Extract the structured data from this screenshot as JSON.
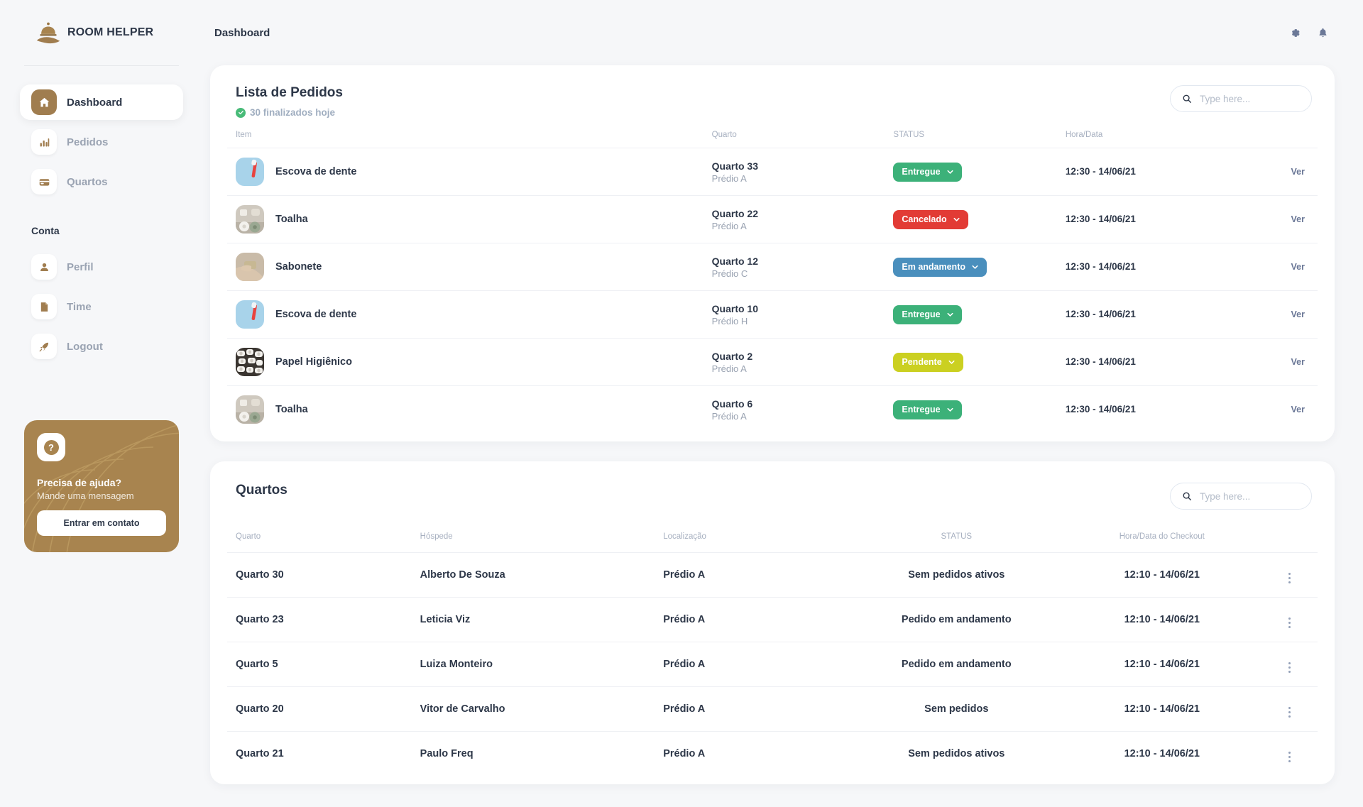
{
  "brand": {
    "name": "ROOM HELPER",
    "logo_icon": "cloche-on-hand-logo"
  },
  "sidebar": {
    "items": [
      {
        "label": "Dashboard",
        "icon": "home-icon",
        "active": true
      },
      {
        "label": "Pedidos",
        "icon": "bar-chart-icon",
        "active": false
      },
      {
        "label": "Quartos",
        "icon": "card-icon",
        "active": false
      }
    ],
    "section_title": "Conta",
    "account_items": [
      {
        "label": "Perfil",
        "icon": "person-icon"
      },
      {
        "label": "Time",
        "icon": "document-icon"
      },
      {
        "label": "Logout",
        "icon": "rocket-icon"
      }
    ],
    "help_card": {
      "icon": "question-mark-icon",
      "title": "Precisa de ajuda?",
      "subtitle": "Mande uma mensagem",
      "button_label": "Entrar em contato",
      "background_color": "#a8844f"
    }
  },
  "topbar": {
    "breadcrumb": "Dashboard",
    "icons": [
      {
        "name": "gear-icon"
      },
      {
        "name": "bell-icon"
      }
    ]
  },
  "orders_card": {
    "title": "Lista de Pedidos",
    "subtitle": "30 finalizados hoje",
    "subtitle_icon": "check-circle-icon",
    "search": {
      "placeholder": "Type here...",
      "value": "",
      "icon": "search-icon"
    },
    "columns": [
      "Item",
      "Quarto",
      "STATUS",
      "Hora/Data",
      ""
    ],
    "rows": [
      {
        "item": "Escova de dente",
        "thumb": "toothbrush",
        "room": "Quarto 33",
        "building": "Prédio A",
        "status": "Entregue",
        "status_color": "green",
        "datetime": "12:30 - 14/06/21",
        "action": "Ver"
      },
      {
        "item": "Toalha",
        "thumb": "towel",
        "room": "Quarto 22",
        "building": "Prédio A",
        "status": "Cancelado",
        "status_color": "red",
        "datetime": "12:30 - 14/06/21",
        "action": "Ver"
      },
      {
        "item": "Sabonete",
        "thumb": "soap",
        "room": "Quarto 12",
        "building": "Prédio C",
        "status": "Em andamento",
        "status_color": "blue",
        "datetime": "12:30 - 14/06/21",
        "action": "Ver"
      },
      {
        "item": "Escova de dente",
        "thumb": "toothbrush",
        "room": "Quarto 10",
        "building": "Prédio H",
        "status": "Entregue",
        "status_color": "green",
        "datetime": "12:30 - 14/06/21",
        "action": "Ver"
      },
      {
        "item": "Papel Higiênico",
        "thumb": "toiletpaper",
        "room": "Quarto 2",
        "building": "Prédio A",
        "status": "Pendente",
        "status_color": "yellow",
        "datetime": "12:30 - 14/06/21",
        "action": "Ver"
      },
      {
        "item": "Toalha",
        "thumb": "towel",
        "room": "Quarto 6",
        "building": "Prédio A",
        "status": "Entregue",
        "status_color": "green",
        "datetime": "12:30 - 14/06/21",
        "action": "Ver"
      }
    ]
  },
  "rooms_card": {
    "title": "Quartos",
    "search": {
      "placeholder": "Type here...",
      "value": "",
      "icon": "search-icon"
    },
    "columns": [
      "Quarto",
      "Hóspede",
      "Localização",
      "STATUS",
      "Hora/Data do Checkout",
      ""
    ],
    "rows": [
      {
        "room": "Quarto 30",
        "guest": "Alberto De Souza",
        "location": "Prédio A",
        "status": "Sem pedidos ativos",
        "checkout": "12:10 - 14/06/21"
      },
      {
        "room": "Quarto 23",
        "guest": "Leticia Viz",
        "location": "Prédio A",
        "status": "Pedido em andamento",
        "checkout": "12:10 - 14/06/21"
      },
      {
        "room": "Quarto 5",
        "guest": "Luiza Monteiro",
        "location": "Prédio A",
        "status": "Pedido em andamento",
        "checkout": "12:10 - 14/06/21"
      },
      {
        "room": "Quarto 20",
        "guest": "Vitor de Carvalho",
        "location": "Prédio A",
        "status": "Sem pedidos",
        "checkout": "12:10 - 14/06/21"
      },
      {
        "room": "Quarto 21",
        "guest": "Paulo Freq",
        "location": "Prédio A",
        "status": "Sem pedidos ativos",
        "checkout": "12:10 - 14/06/21"
      }
    ]
  },
  "theme": {
    "accent": "#a07d4f",
    "page_bg": "#f6f7f9",
    "text": "#2d3748",
    "muted": "#9aa3b2",
    "status_green": "#3cb179",
    "status_red": "#e23b35",
    "status_blue": "#4a8fbd",
    "status_yellow": "#cbd021"
  }
}
